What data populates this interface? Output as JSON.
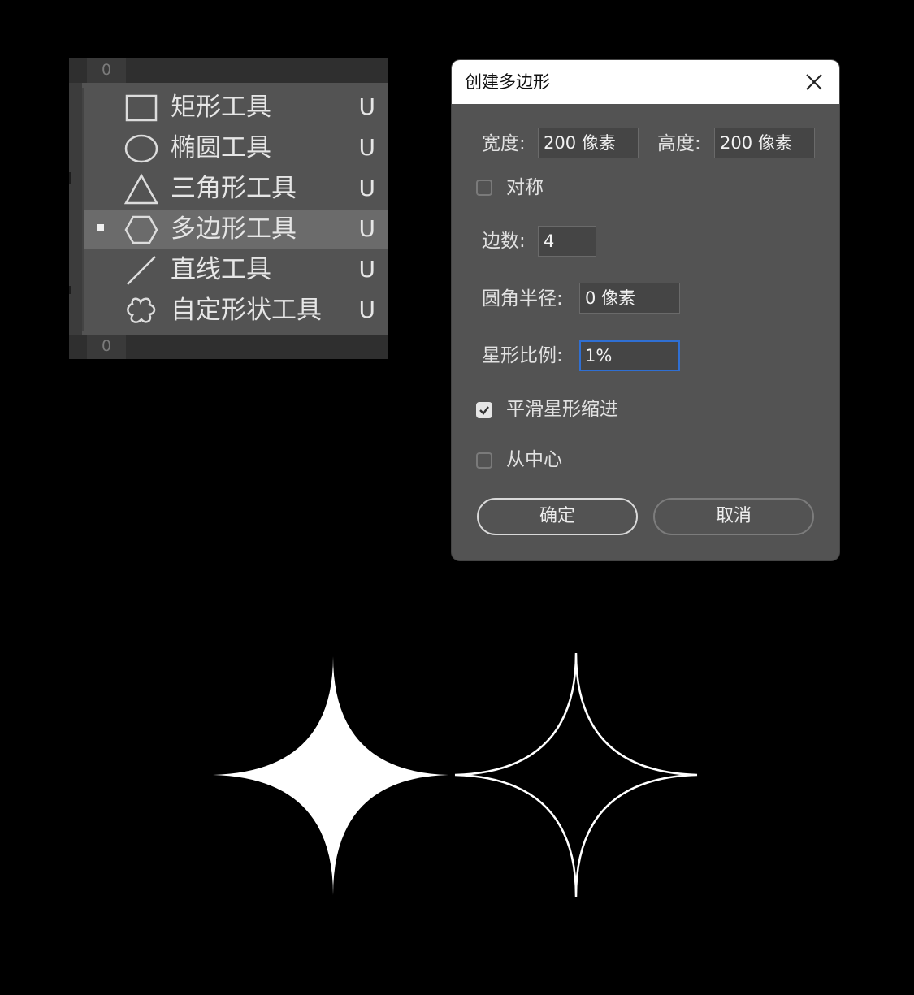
{
  "flyout": {
    "top_tab": "0",
    "bottom_tab": "0",
    "items": [
      {
        "label": "矩形工具",
        "shortcut": "U",
        "icon": "rectangle-icon"
      },
      {
        "label": "椭圆工具",
        "shortcut": "U",
        "icon": "ellipse-icon"
      },
      {
        "label": "三角形工具",
        "shortcut": "U",
        "icon": "triangle-icon"
      },
      {
        "label": "多边形工具",
        "shortcut": "U",
        "icon": "polygon-icon",
        "active": true
      },
      {
        "label": "直线工具",
        "shortcut": "U",
        "icon": "line-icon"
      },
      {
        "label": "自定形状工具",
        "shortcut": "U",
        "icon": "custom-shape-icon"
      }
    ]
  },
  "dialog": {
    "title": "创建多边形",
    "width_label": "宽度:",
    "width_value": "200 像素",
    "height_label": "高度:",
    "height_value": "200 像素",
    "symmetric_label": "对称",
    "symmetric_checked": false,
    "sides_label": "边数:",
    "sides_value": "4",
    "corner_radius_label": "圆角半径:",
    "corner_radius_value": "0 像素",
    "star_ratio_label": "星形比例:",
    "star_ratio_value": "1%",
    "smooth_star_label": "平滑星形缩进",
    "smooth_star_checked": true,
    "from_center_label": "从中心",
    "from_center_checked": false,
    "ok_label": "确定",
    "cancel_label": "取消"
  },
  "colors": {
    "panel_bg": "#535353",
    "dialog_bg": "#535353",
    "focus_border": "#2f6fd3",
    "star_fill": "#ffffff",
    "background": "#000000"
  }
}
